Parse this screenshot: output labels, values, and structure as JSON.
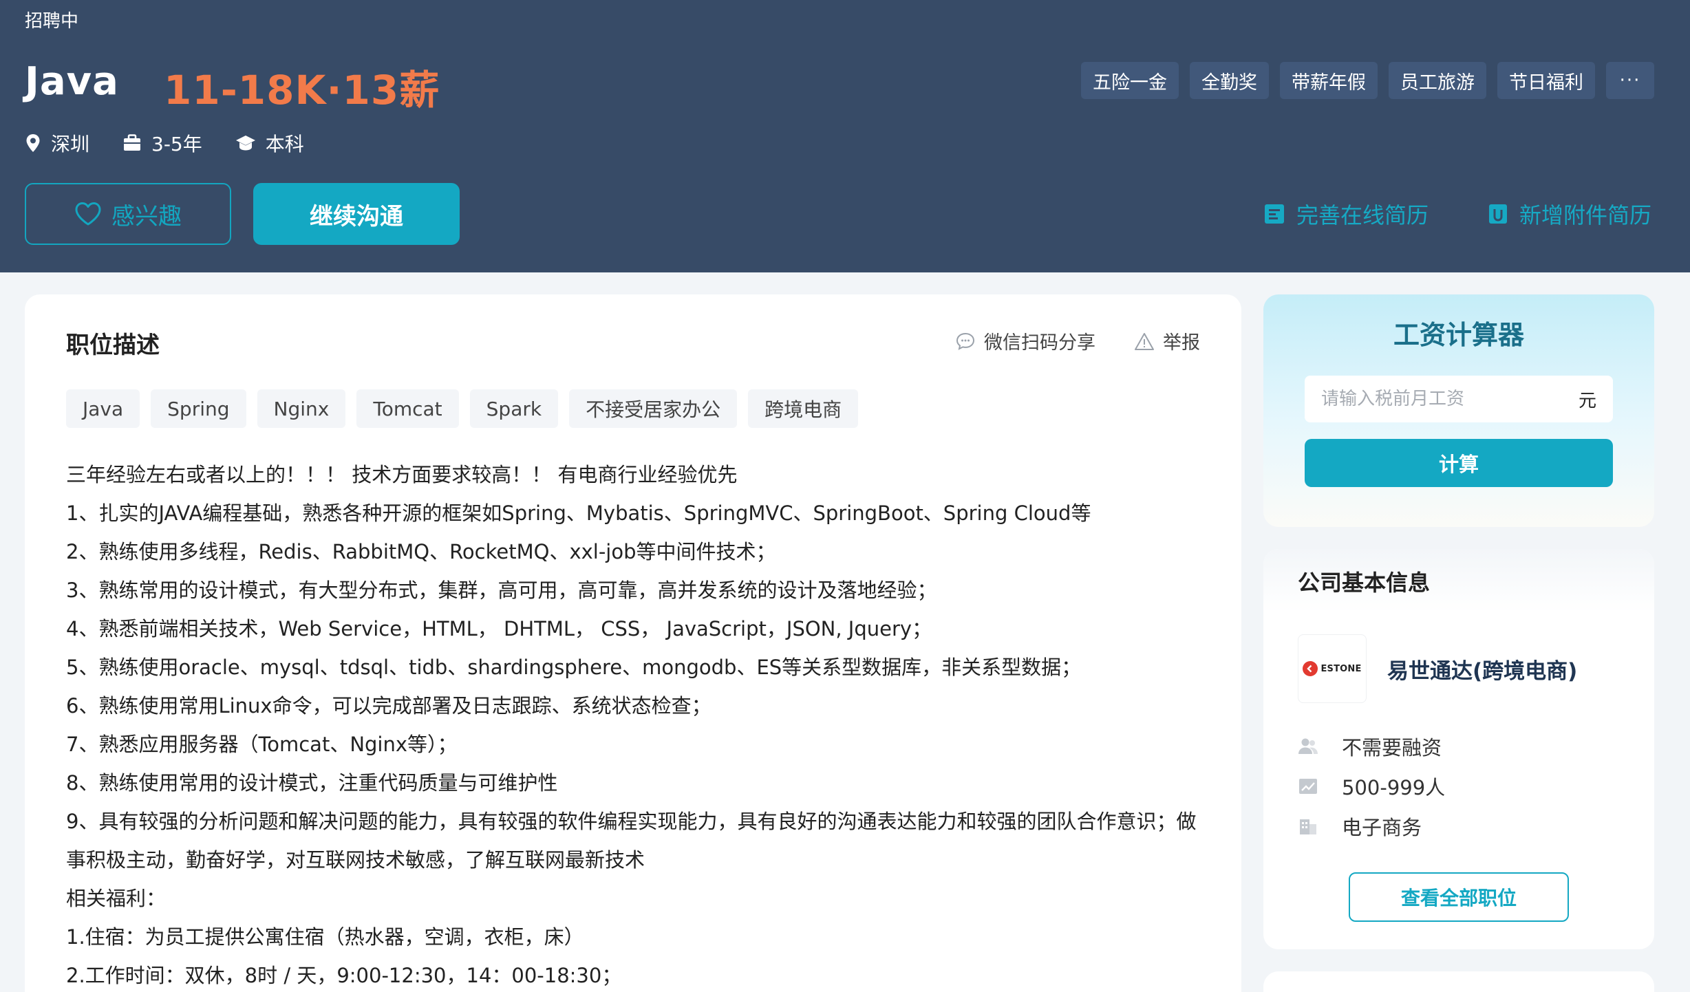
{
  "header": {
    "status": "招聘中",
    "job_title": "Java",
    "salary": "11-18K·13薪",
    "meta": {
      "location": "深圳",
      "experience": "3-5年",
      "education": "本科"
    },
    "benefits": [
      "五险一金",
      "全勤奖",
      "带薪年假",
      "员工旅游",
      "节日福利"
    ],
    "benefits_more": "···",
    "interest_label": "感兴趣",
    "chat_label": "继续沟通",
    "resume_online": "完善在线简历",
    "resume_attach": "新增附件简历"
  },
  "job": {
    "section_title": "职位描述",
    "share_label": "微信扫码分享",
    "report_label": "举报",
    "tags": [
      "Java",
      "Spring",
      "Nginx",
      "Tomcat",
      "Spark",
      "不接受居家办公",
      "跨境电商"
    ],
    "description": [
      "三年经验左右或者以上的！！！ 技术方面要求较高！！ 有电商行业经验优先",
      "1、扎实的JAVA编程基础，熟悉各种开源的框架如Spring、Mybatis、SpringMVC、SpringBoot、Spring Cloud等",
      "2、熟练使用多线程，Redis、RabbitMQ、RocketMQ、xxl-job等中间件技术；",
      "3、熟练常用的设计模式，有大型分布式，集群，高可用，高可靠，高并发系统的设计及落地经验；",
      "4、熟悉前端相关技术，Web Service，HTML， DHTML， CSS， JavaScript，JSON, Jquery；",
      "5、熟练使用oracle、mysql、tdsql、tidb、shardingsphere、mongodb、ES等关系型数据库，非关系型数据；",
      "6、熟练使用常用Linux命令，可以完成部署及日志跟踪、系统状态检查；",
      "7、熟悉应用服务器（Tomcat、Nginx等）；",
      "8、熟练使用常用的设计模式，注重代码质量与可维护性",
      "9、具有较强的分析问题和解决问题的能力，具有较强的软件编程实现能力，具有良好的沟通表达能力和较强的团队合作意识；做事积极主动，勤奋好学，对互联网技术敏感，了解互联网最新技术",
      "相关福利：",
      "1.住宿：为员工提供公寓住宿（热水器，空调，衣柜，床）",
      "2.工作时间：双休，8时 / 天，9:00-12:30，14：00-18:30；"
    ]
  },
  "calculator": {
    "title": "工资计算器",
    "placeholder": "请输入税前月工资",
    "unit": "元",
    "button": "计算"
  },
  "company": {
    "section_title": "公司基本信息",
    "logo_text": "ESTONE",
    "name": "易世通达(跨境电商)",
    "financing": "不需要融资",
    "size": "500-999人",
    "industry": "电子商务",
    "all_jobs_label": "查看全部职位"
  },
  "colors": {
    "header_bg": "#374b67",
    "accent": "#14a8c3",
    "salary": "#f27b4a"
  }
}
